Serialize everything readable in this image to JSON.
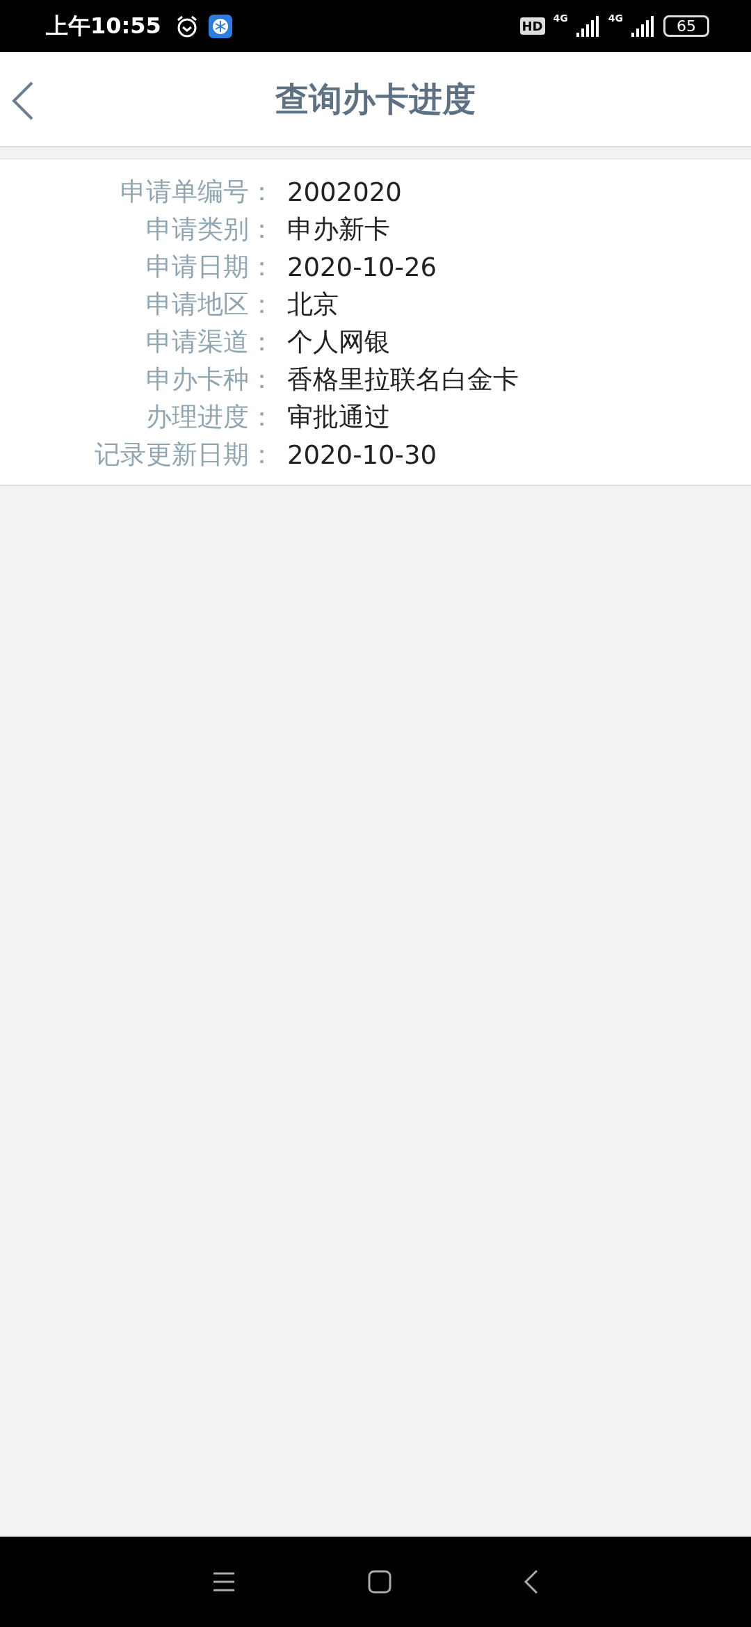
{
  "status_bar": {
    "time": "上午10:55",
    "hd": "HD",
    "networks": [
      "4G",
      "4G"
    ],
    "battery": "65"
  },
  "header": {
    "title": "查询办卡进度"
  },
  "details": [
    {
      "label": "申请单编号：",
      "value": "2002020"
    },
    {
      "label": "申请类别：",
      "value": "申办新卡"
    },
    {
      "label": "申请日期：",
      "value": "2020-10-26"
    },
    {
      "label": "申请地区：",
      "value": "北京"
    },
    {
      "label": "申请渠道：",
      "value": "个人网银"
    },
    {
      "label": "申办卡种：",
      "value": "香格里拉联名白金卡"
    },
    {
      "label": "办理进度：",
      "value": "审批通过"
    },
    {
      "label": "记录更新日期：",
      "value": "2020-10-30"
    }
  ]
}
